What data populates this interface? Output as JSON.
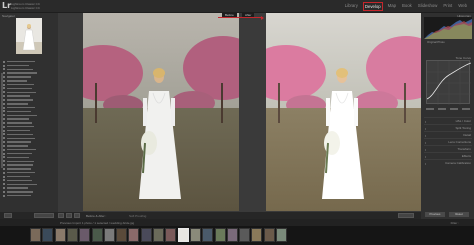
{
  "app": {
    "logo": "Lr",
    "title": "Lightroom Classic CC",
    "subtitle": "Lightroom Classic CC"
  },
  "modules": [
    "Library",
    "Develop",
    "Map",
    "Book",
    "Slideshow",
    "Print",
    "Web"
  ],
  "active_module": "Develop",
  "left_panel": {
    "navigator_label": "Navigator"
  },
  "compare": {
    "before_label": "Before",
    "after_label": "After"
  },
  "right_panel": {
    "histogram_label": "Histogram",
    "original_photo_label": "Original Photo",
    "tone_curve_label": "Tone Curve",
    "sections": [
      "HSL / Color",
      "Split Toning",
      "Detail",
      "Lens Corrections",
      "Transform",
      "Effects",
      "Camera Calibration"
    ],
    "previous_label": "Previous",
    "reset_label": "Reset"
  },
  "toolbar": {
    "before_after_text": "Before & After :",
    "soft_proofing_text": "Soft Proofing"
  },
  "filmstrip": {
    "info_text": "Previous Import  1 photo / 1 selected / wedding-bride.jpg",
    "filter_text": "Filter :"
  },
  "colors": {
    "accent": "#c5262c",
    "panel": "#303030",
    "background": "#3a3a3a"
  }
}
